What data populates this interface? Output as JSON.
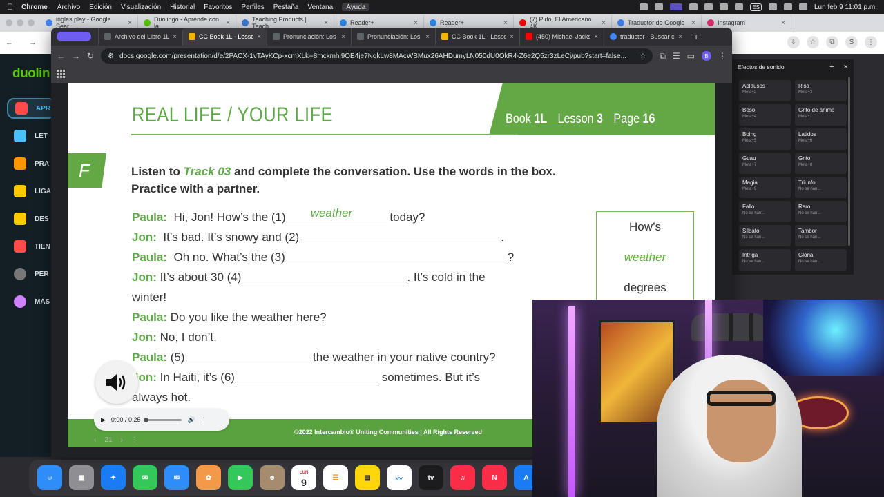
{
  "menubar": {
    "app": "Chrome",
    "items": [
      "Archivo",
      "Edición",
      "Visualización",
      "Historial",
      "Favoritos",
      "Perfiles",
      "Pestaña",
      "Ventana",
      "Ayuda"
    ],
    "lang": "ES",
    "clock": "Lun feb 9  11:01 p.m."
  },
  "bg_tabs": [
    {
      "title": "ingles play - Google Sear",
      "color": "#4285f4"
    },
    {
      "title": "Duolingo - Aprende con la",
      "color": "#58cc02"
    },
    {
      "title": "Teaching Products | Teach",
      "color": "#3a7bd5"
    },
    {
      "title": "Reader+",
      "color": "#2d8cf0"
    },
    {
      "title": "Reader+",
      "color": "#2d8cf0"
    },
    {
      "title": "(7) Pirlo, El Americano 4K",
      "color": "#ff0000"
    },
    {
      "title": "Traductor de Google",
      "color": "#4285f4"
    },
    {
      "title": "Instagram",
      "color": "#e1306c"
    }
  ],
  "duolingo": {
    "logo": "duolin",
    "nav": [
      {
        "label": "APR",
        "color": "#ff4b4b"
      },
      {
        "label": "LET",
        "color": "#49c0f8"
      },
      {
        "label": "PRA",
        "color": "#ff9600"
      },
      {
        "label": "LIGA",
        "color": "#ffc800"
      },
      {
        "label": "DES",
        "color": "#ffc800"
      },
      {
        "label": "TIEN",
        "color": "#ff4b4b"
      },
      {
        "label": "PER",
        "color": "#777777"
      },
      {
        "label": "MÁS",
        "color": "#ce82ff"
      }
    ]
  },
  "window": {
    "tabs": [
      {
        "title": "Archivo del Libro 1L",
        "color": "#5f6368",
        "active": false
      },
      {
        "title": "CC Book 1L - Lesson",
        "color": "#f4b400",
        "active": true
      },
      {
        "title": "Pronunciación: Los s",
        "color": "#5f6368",
        "active": false
      },
      {
        "title": "Pronunciación: Los s",
        "color": "#5f6368",
        "active": false
      },
      {
        "title": "CC Book 1L - Lesson",
        "color": "#f4b400",
        "active": false
      },
      {
        "title": "(450) Michael Jacks",
        "color": "#ff0000",
        "active": false
      },
      {
        "title": "traductor - Buscar c",
        "color": "#4285f4",
        "active": false
      }
    ],
    "new_tab": "+",
    "url": "docs.google.com/presentation/d/e/2PACX-1vTAyKCp-xcmXLk--8mckmhj9OE4je7NqkLw8MAcWBMux26AHDumyLN050dU0OkR4-Z6e2Q5zr3zLeCj/pub?start=false...",
    "profile_initial": "B"
  },
  "slide": {
    "title": "REAL LIFE / YOUR LIFE",
    "book_label": "Book",
    "book_value": "1L",
    "lesson_label": "Lesson",
    "lesson_value": "3",
    "page_label": "Page",
    "page_value": "16",
    "section": "F",
    "instr_a": "Listen to ",
    "instr_track": "Track 03",
    "instr_b": " and complete the conversation. Use the words in the box.",
    "instr_c": "Practice with a partner.",
    "speakers": {
      "paula": "Paula:",
      "jon": "Jon:"
    },
    "lines": {
      "l1a": "Hi, Jon! How’s the (1)",
      "l1ans": "weather",
      "l1b": "today?",
      "l2a": "It’s bad. It’s snowy and (2)",
      "l2b": ".",
      "l3a": "Oh no. What’s the (3)",
      "l3b": "?",
      "l4a": "It’s about 30 (4)",
      "l4b": ". It’s cold in the",
      "l4c": "winter!",
      "l5": "Do you like the weather here?",
      "l6": "No, I don’t.",
      "l7a": "(5)",
      "l7b": "the weather in your native country?",
      "l8a": "In Haiti, it’s (6)",
      "l8b": "sometimes. But it’s",
      "l8c": "always hot."
    },
    "word_box": [
      "How’s",
      "weather",
      "degrees"
    ],
    "footer": "©2022 Intercambio® Uniting Communities   |   All Rights Reserved",
    "audio_time": "0:00 / 0:25",
    "page_num": "21"
  },
  "sfx": {
    "title": "Efectos de sonido",
    "buttons": [
      {
        "name": "Aplausos",
        "sub": "Meta+2"
      },
      {
        "name": "Risa",
        "sub": "Meta+3"
      },
      {
        "name": "Beso",
        "sub": "Meta+4"
      },
      {
        "name": "Grito de ánimo",
        "sub": "Meta+1"
      },
      {
        "name": "Boing",
        "sub": "Meta+5"
      },
      {
        "name": "Latidos",
        "sub": "Meta+6"
      },
      {
        "name": "Guau",
        "sub": "Meta+7"
      },
      {
        "name": "Grito",
        "sub": "Meta+8"
      },
      {
        "name": "Magia",
        "sub": "Meta+9"
      },
      {
        "name": "Triunfo",
        "sub": "No se han..."
      },
      {
        "name": "Fallo",
        "sub": "No se han..."
      },
      {
        "name": "Raro",
        "sub": "No se han..."
      },
      {
        "name": "Silbato",
        "sub": "No se han..."
      },
      {
        "name": "Tambor",
        "sub": "No se han..."
      },
      {
        "name": "Intriga",
        "sub": "No se han..."
      },
      {
        "name": "Gloria",
        "sub": "No se han..."
      }
    ]
  },
  "dock": [
    {
      "name": "finder-icon",
      "color": "#2f8dfa"
    },
    {
      "name": "launchpad-icon",
      "color": "#8e8e93"
    },
    {
      "name": "safari-icon",
      "color": "#1a7cf5"
    },
    {
      "name": "messages-icon",
      "color": "#34c759"
    },
    {
      "name": "mail-icon",
      "color": "#2f8dfa"
    },
    {
      "name": "photos-icon",
      "color": "#f2994a"
    },
    {
      "name": "facetime-icon",
      "color": "#34c759"
    },
    {
      "name": "contacts-icon",
      "color": "#a58c6f"
    },
    {
      "name": "calendar-icon",
      "color": "#ffffff"
    },
    {
      "name": "reminders-icon",
      "color": "#ffffff"
    },
    {
      "name": "notes-icon",
      "color": "#ffd60a"
    },
    {
      "name": "freeform-icon",
      "color": "#ffffff"
    },
    {
      "name": "tv-icon",
      "color": "#1c1c1e"
    },
    {
      "name": "music-icon",
      "color": "#fa2d48"
    },
    {
      "name": "news-icon",
      "color": "#fa2d48"
    },
    {
      "name": "appstore-icon",
      "color": "#1a7cf5"
    }
  ],
  "calendar": {
    "month": "LUN",
    "day": "9"
  },
  "tv_label": "tv"
}
